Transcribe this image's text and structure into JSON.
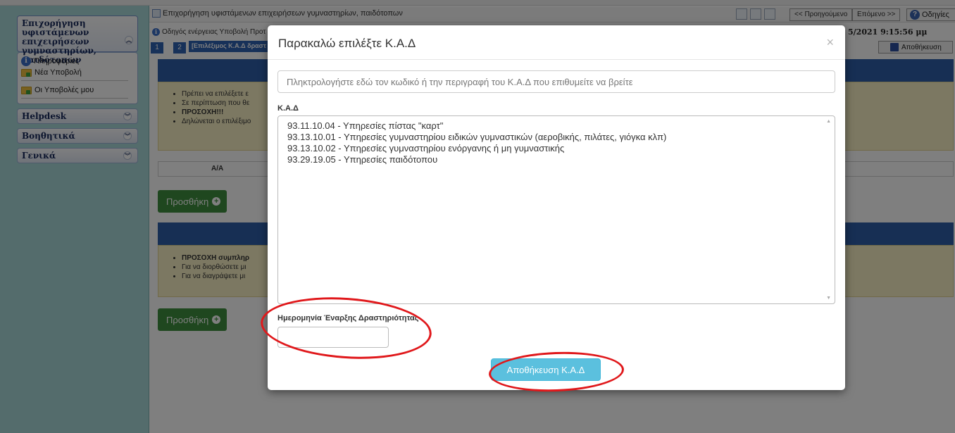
{
  "sidebar": {
    "main_section": "Επιχορήγηση υφιστάμενων επιχειρήσεων γυμναστηρίων, παιδότοπων",
    "main_items": [
      {
        "label": "Πληροφορίες",
        "icon": "info-icon"
      },
      {
        "label": "Νέα Υποβολή",
        "icon": "folder-add-icon"
      },
      {
        "label": "Οι Υποβολές μου",
        "icon": "folder-add-icon"
      }
    ],
    "sections": [
      "Helpdesk",
      "Βοηθητικά",
      "Γενικά"
    ]
  },
  "header": {
    "title": "Επιχορήγηση υφιστάμενων επιχειρήσεων γυμναστηρίων, παιδότοπων",
    "prev_label": "<< Προηγούμενο",
    "next_label": "Επόμενο >>",
    "help_label": "Οδηγίες",
    "guide_text": "Οδηγός ενέργειας Υποβολή Προτ",
    "datetime": "5/2021 9:15:56 μμ",
    "save_label": "Αποθήκευση"
  },
  "steps": {
    "step1": "1",
    "step2": "2",
    "step2_label": "[Επιλέξιμος Κ.Α.Δ δραστ"
  },
  "background": {
    "bullets_top": [
      "Πρέπει να επιλέξετε ε",
      "Σε περίπτωση που θε",
      "ΠΡΟΣΟΧΗ!!!",
      "Δηλώνεται ο επιλέξιμο"
    ],
    "table_header_aa": "Α/Α",
    "add_label": "Προσθήκη",
    "bullets_bottom": [
      "ΠΡΟΣΟΧΗ συμπληρ",
      "Για να διορθώσετε μι",
      "Για να διαγράψετε μι"
    ]
  },
  "modal": {
    "title": "Παρακαλώ επιλέξτε Κ.Α.Δ",
    "close": "×",
    "search_placeholder": "Πληκτρολογήστε εδώ τον κωδικό ή την περιγραφή του Κ.Α.Δ που επιθυμείτε να βρείτε",
    "kad_label": "Κ.Α.Δ",
    "kad_options": [
      "93.11.10.04 - Υπηρεσίες πίστας \"καρτ\"",
      "93.13.10.01 - Υπηρεσίες γυμναστηρίου ειδικών γυμναστικών (αεροβικής, πιλάτες, γιόγκα κλπ)",
      "93.13.10.02 - Υπηρεσίες γυμναστηρίου ενόργανης ή μη γυμναστικής",
      "93.29.19.05 - Υπηρεσίες παιδότοπου"
    ],
    "date_label": "Ημερομηνία Έναρξης Δραστηριότητας",
    "date_value": "",
    "save_button": "Αποθήκευση Κ.Α.Δ"
  },
  "colors": {
    "sidebar_bg": "#a9d9d9",
    "band_blue": "#2e5ea8",
    "add_green": "#3e8e3e",
    "save_info": "#5bc0de",
    "annotation_red": "#e0181b"
  }
}
